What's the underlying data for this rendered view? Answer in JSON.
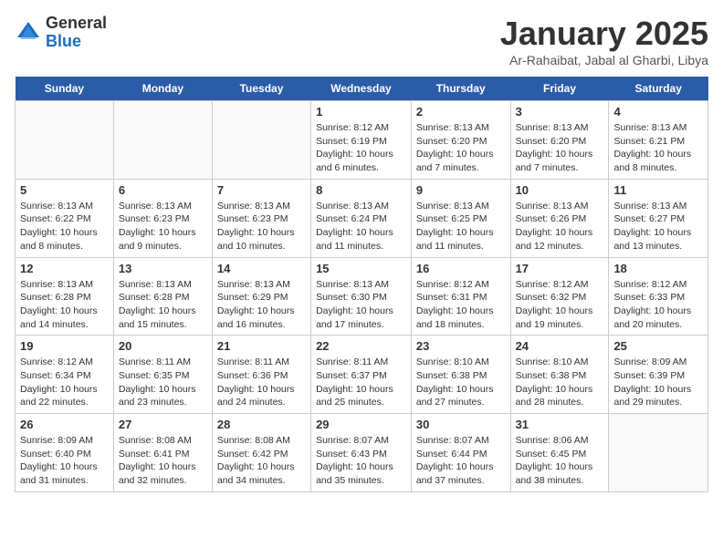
{
  "header": {
    "logo_general": "General",
    "logo_blue": "Blue",
    "month_title": "January 2025",
    "location": "Ar-Rahaibat, Jabal al Gharbi, Libya"
  },
  "days": [
    "Sunday",
    "Monday",
    "Tuesday",
    "Wednesday",
    "Thursday",
    "Friday",
    "Saturday"
  ],
  "weeks": [
    [
      {
        "num": "",
        "text": ""
      },
      {
        "num": "",
        "text": ""
      },
      {
        "num": "",
        "text": ""
      },
      {
        "num": "1",
        "text": "Sunrise: 8:12 AM\nSunset: 6:19 PM\nDaylight: 10 hours\nand 6 minutes."
      },
      {
        "num": "2",
        "text": "Sunrise: 8:13 AM\nSunset: 6:20 PM\nDaylight: 10 hours\nand 7 minutes."
      },
      {
        "num": "3",
        "text": "Sunrise: 8:13 AM\nSunset: 6:20 PM\nDaylight: 10 hours\nand 7 minutes."
      },
      {
        "num": "4",
        "text": "Sunrise: 8:13 AM\nSunset: 6:21 PM\nDaylight: 10 hours\nand 8 minutes."
      }
    ],
    [
      {
        "num": "5",
        "text": "Sunrise: 8:13 AM\nSunset: 6:22 PM\nDaylight: 10 hours\nand 8 minutes."
      },
      {
        "num": "6",
        "text": "Sunrise: 8:13 AM\nSunset: 6:23 PM\nDaylight: 10 hours\nand 9 minutes."
      },
      {
        "num": "7",
        "text": "Sunrise: 8:13 AM\nSunset: 6:23 PM\nDaylight: 10 hours\nand 10 minutes."
      },
      {
        "num": "8",
        "text": "Sunrise: 8:13 AM\nSunset: 6:24 PM\nDaylight: 10 hours\nand 11 minutes."
      },
      {
        "num": "9",
        "text": "Sunrise: 8:13 AM\nSunset: 6:25 PM\nDaylight: 10 hours\nand 11 minutes."
      },
      {
        "num": "10",
        "text": "Sunrise: 8:13 AM\nSunset: 6:26 PM\nDaylight: 10 hours\nand 12 minutes."
      },
      {
        "num": "11",
        "text": "Sunrise: 8:13 AM\nSunset: 6:27 PM\nDaylight: 10 hours\nand 13 minutes."
      }
    ],
    [
      {
        "num": "12",
        "text": "Sunrise: 8:13 AM\nSunset: 6:28 PM\nDaylight: 10 hours\nand 14 minutes."
      },
      {
        "num": "13",
        "text": "Sunrise: 8:13 AM\nSunset: 6:28 PM\nDaylight: 10 hours\nand 15 minutes."
      },
      {
        "num": "14",
        "text": "Sunrise: 8:13 AM\nSunset: 6:29 PM\nDaylight: 10 hours\nand 16 minutes."
      },
      {
        "num": "15",
        "text": "Sunrise: 8:13 AM\nSunset: 6:30 PM\nDaylight: 10 hours\nand 17 minutes."
      },
      {
        "num": "16",
        "text": "Sunrise: 8:12 AM\nSunset: 6:31 PM\nDaylight: 10 hours\nand 18 minutes."
      },
      {
        "num": "17",
        "text": "Sunrise: 8:12 AM\nSunset: 6:32 PM\nDaylight: 10 hours\nand 19 minutes."
      },
      {
        "num": "18",
        "text": "Sunrise: 8:12 AM\nSunset: 6:33 PM\nDaylight: 10 hours\nand 20 minutes."
      }
    ],
    [
      {
        "num": "19",
        "text": "Sunrise: 8:12 AM\nSunset: 6:34 PM\nDaylight: 10 hours\nand 22 minutes."
      },
      {
        "num": "20",
        "text": "Sunrise: 8:11 AM\nSunset: 6:35 PM\nDaylight: 10 hours\nand 23 minutes."
      },
      {
        "num": "21",
        "text": "Sunrise: 8:11 AM\nSunset: 6:36 PM\nDaylight: 10 hours\nand 24 minutes."
      },
      {
        "num": "22",
        "text": "Sunrise: 8:11 AM\nSunset: 6:37 PM\nDaylight: 10 hours\nand 25 minutes."
      },
      {
        "num": "23",
        "text": "Sunrise: 8:10 AM\nSunset: 6:38 PM\nDaylight: 10 hours\nand 27 minutes."
      },
      {
        "num": "24",
        "text": "Sunrise: 8:10 AM\nSunset: 6:38 PM\nDaylight: 10 hours\nand 28 minutes."
      },
      {
        "num": "25",
        "text": "Sunrise: 8:09 AM\nSunset: 6:39 PM\nDaylight: 10 hours\nand 29 minutes."
      }
    ],
    [
      {
        "num": "26",
        "text": "Sunrise: 8:09 AM\nSunset: 6:40 PM\nDaylight: 10 hours\nand 31 minutes."
      },
      {
        "num": "27",
        "text": "Sunrise: 8:08 AM\nSunset: 6:41 PM\nDaylight: 10 hours\nand 32 minutes."
      },
      {
        "num": "28",
        "text": "Sunrise: 8:08 AM\nSunset: 6:42 PM\nDaylight: 10 hours\nand 34 minutes."
      },
      {
        "num": "29",
        "text": "Sunrise: 8:07 AM\nSunset: 6:43 PM\nDaylight: 10 hours\nand 35 minutes."
      },
      {
        "num": "30",
        "text": "Sunrise: 8:07 AM\nSunset: 6:44 PM\nDaylight: 10 hours\nand 37 minutes."
      },
      {
        "num": "31",
        "text": "Sunrise: 8:06 AM\nSunset: 6:45 PM\nDaylight: 10 hours\nand 38 minutes."
      },
      {
        "num": "",
        "text": ""
      }
    ]
  ]
}
